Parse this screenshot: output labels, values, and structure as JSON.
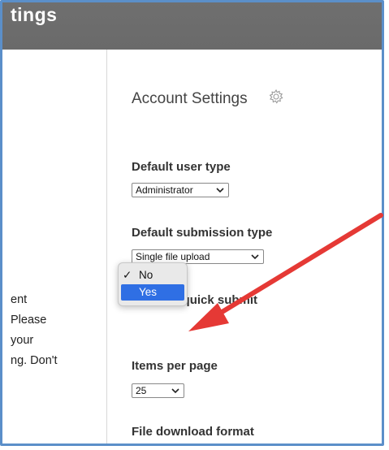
{
  "header": {
    "title": "tings"
  },
  "left_panel": {
    "lines": [
      "ent",
      "Please",
      "your",
      "ng. Don't"
    ]
  },
  "section": {
    "title": "Account Settings",
    "icon": "gear-icon"
  },
  "fields": {
    "default_user_type": {
      "label": "Default user type",
      "value": "Administrator"
    },
    "default_submission_type": {
      "label": "Default submission type",
      "value": "Single file upload"
    },
    "activate_quick_submit": {
      "label": "Activate quick submit"
    },
    "items_per_page": {
      "label": "Items per page",
      "value": "25"
    },
    "file_download_format": {
      "label": "File download format"
    }
  },
  "dropdown": {
    "options": [
      {
        "label": "No",
        "checked": true
      },
      {
        "label": "Yes",
        "highlighted": true
      }
    ],
    "check_glyph": "✓"
  },
  "annotation": {
    "arrow_color": "#e53935"
  },
  "colors": {
    "frame_border": "#5b8fc9",
    "header_bg": "#6e6e6e",
    "highlight": "#2f6fe4"
  }
}
